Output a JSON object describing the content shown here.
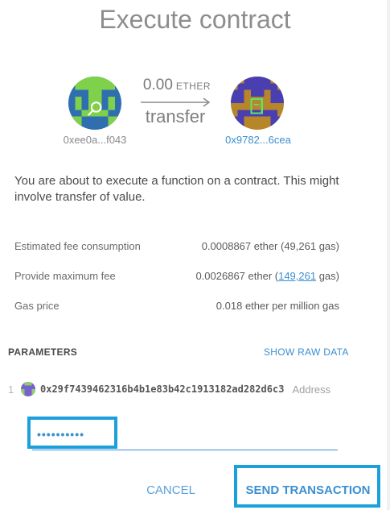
{
  "dialog": {
    "title": "Execute contract"
  },
  "transfer": {
    "amount": "0.00",
    "unit": "ETHER",
    "label": "transfer",
    "from_address": "0xee0a...f043",
    "to_address": "0x9782...6cea",
    "from_avatar_icon": "identicon-avatar-icon",
    "to_avatar_icon": "identicon-avatar-icon"
  },
  "description": "You are about to execute a function on a contract. This might involve transfer of value.",
  "fees": {
    "estimated_label": "Estimated fee consumption",
    "estimated_value": "0.0008867 ether (49,261 gas)",
    "max_label": "Provide maximum fee",
    "max_value_prefix": "0.0026867 ether (",
    "max_gas_link": "149,261",
    "max_value_suffix": " gas)",
    "gas_price_label": "Gas price",
    "gas_price_value": "0.018 ether per million gas"
  },
  "parameters": {
    "header": "PARAMETERS",
    "raw_data_button": "SHOW RAW DATA",
    "items": [
      {
        "index": "1",
        "value": "0x29f7439462316b4b1e83b42c1913182ad282d6c3",
        "type": "Address"
      }
    ]
  },
  "password": {
    "value": "••••••••••"
  },
  "actions": {
    "cancel": "CANCEL",
    "send": "SEND TRANSACTION"
  },
  "colors": {
    "accent": "#3b8fd1",
    "focus_highlight": "#1ba0dc"
  }
}
